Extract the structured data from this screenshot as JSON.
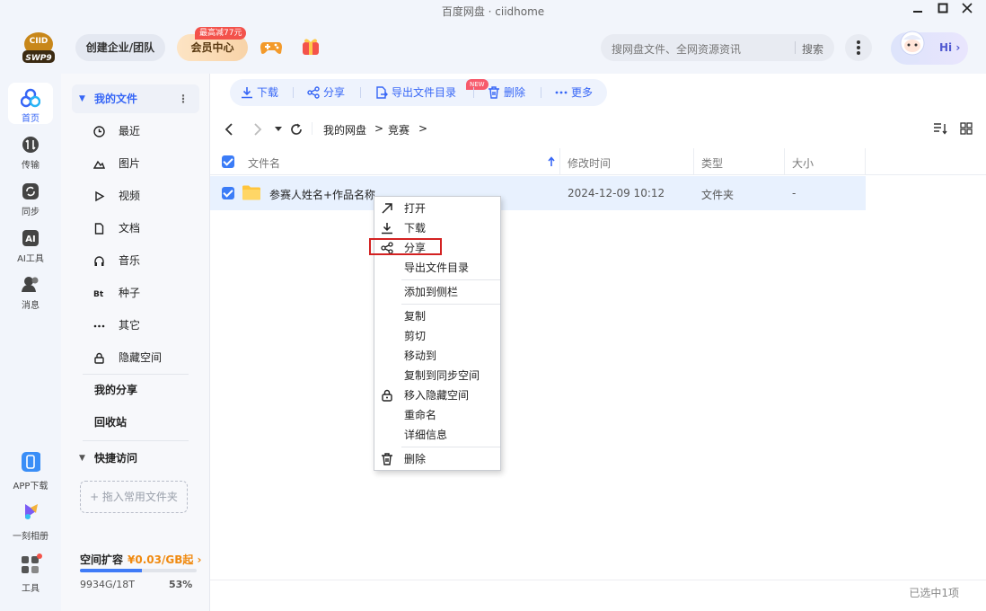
{
  "window": {
    "title": "百度网盘 · ciidhome",
    "controls": [
      "minimize",
      "maximize",
      "close"
    ]
  },
  "header": {
    "logo_text": "CIID",
    "logo_sub": "SWP9",
    "team_button": "创建企业/团队",
    "vip_button": "会员中心",
    "vip_promo": "最高减77元",
    "search_placeholder": "搜网盘文件、全网资源资讯",
    "search_button": "搜索",
    "greeting": "Hi"
  },
  "leftnav": {
    "items": [
      {
        "label": "首页",
        "icon": "home-icon",
        "active": true
      },
      {
        "label": "传输",
        "icon": "transfer-icon"
      },
      {
        "label": "同步",
        "icon": "sync-icon"
      },
      {
        "label": "AI工具",
        "icon": "ai-icon"
      },
      {
        "label": "消息",
        "icon": "message-icon"
      }
    ],
    "bottom": [
      {
        "label": "APP下载",
        "icon": "phone-icon"
      },
      {
        "label": "一刻相册",
        "icon": "album-icon"
      },
      {
        "label": "工具",
        "icon": "tools-icon"
      }
    ]
  },
  "sidebar": {
    "my_files": "我的文件",
    "items": [
      {
        "label": "最近",
        "icon": "clock-icon"
      },
      {
        "label": "图片",
        "icon": "image-icon"
      },
      {
        "label": "视频",
        "icon": "play-icon"
      },
      {
        "label": "文档",
        "icon": "document-icon"
      },
      {
        "label": "音乐",
        "icon": "headphone-icon"
      },
      {
        "label": "种子",
        "icon": "bt-icon"
      },
      {
        "label": "其它",
        "icon": "dots-icon"
      },
      {
        "label": "隐藏空间",
        "icon": "lock-icon"
      }
    ],
    "my_share": "我的分享",
    "recycle": "回收站",
    "quick_access": "快捷访问",
    "dropzone": "+ 拖入常用文件夹",
    "storage": {
      "title": "空间扩容",
      "price": "¥0.03/GB起",
      "used": "9934G/18T",
      "percent": "53%",
      "fraction": 0.53
    }
  },
  "toolbar": {
    "download": "下载",
    "share": "分享",
    "export": "导出文件目录",
    "new_badge": "NEW",
    "delete": "删除",
    "more": "更多"
  },
  "breadcrumb": {
    "root": "我的网盘",
    "current": "竞赛"
  },
  "table": {
    "headers": {
      "name": "文件名",
      "modified": "修改时间",
      "type": "类型",
      "size": "大小"
    },
    "rows": [
      {
        "name": "参赛人姓名+作品名称",
        "modified": "2024-12-09 10:12",
        "type": "文件夹",
        "size": "-"
      }
    ]
  },
  "context_menu": {
    "items": [
      {
        "label": "打开",
        "icon": "open-arrow-icon"
      },
      {
        "label": "下载",
        "icon": "download-icon"
      },
      {
        "label": "分享",
        "icon": "share-icon",
        "highlighted": true
      },
      {
        "label": "导出文件目录"
      },
      {
        "label": "添加到侧栏"
      },
      {
        "label": "复制"
      },
      {
        "label": "剪切"
      },
      {
        "label": "移动到"
      },
      {
        "label": "复制到同步空间"
      },
      {
        "label": "移入隐藏空间",
        "icon": "lock-icon"
      },
      {
        "label": "重命名"
      },
      {
        "label": "详细信息"
      },
      {
        "label": "删除",
        "icon": "trash-icon"
      }
    ]
  },
  "status": "已选中1项",
  "colors": {
    "accent": "#3666f6",
    "highlight_border": "#d32222",
    "selected_row": "#e8f1fe"
  }
}
